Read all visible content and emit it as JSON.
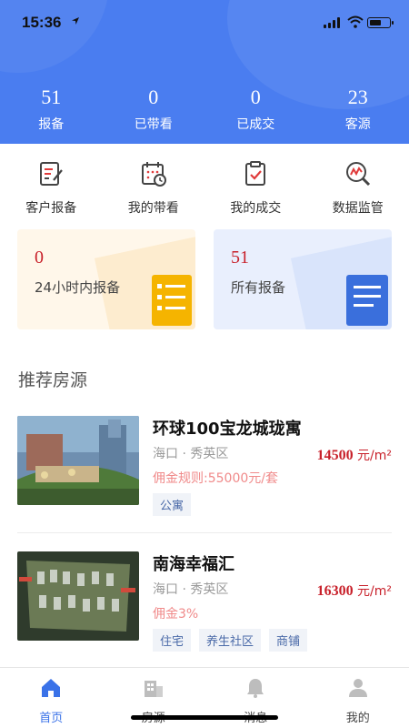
{
  "status_bar": {
    "time": "15:36"
  },
  "stats": [
    {
      "value": "51",
      "label": "报备"
    },
    {
      "value": "0",
      "label": "已带看"
    },
    {
      "value": "0",
      "label": "已成交"
    },
    {
      "value": "23",
      "label": "客源"
    }
  ],
  "actions": [
    {
      "label": "客户报备",
      "icon": "edit-report-icon"
    },
    {
      "label": "我的带看",
      "icon": "calendar-clock-icon"
    },
    {
      "label": "我的成交",
      "icon": "clipboard-check-icon"
    },
    {
      "label": "数据监管",
      "icon": "magnify-chart-icon"
    }
  ],
  "summary_cards": [
    {
      "value": "0",
      "label": "24小时内报备"
    },
    {
      "value": "51",
      "label": "所有报备"
    }
  ],
  "section_title": "推荐房源",
  "listings": [
    {
      "name": "环球100宝龙城珑寓",
      "location": "海口 · 秀英区",
      "price": "14500",
      "price_unit": "元/m²",
      "commission": "佣金规则:55000元/套",
      "tags": [
        "公寓"
      ]
    },
    {
      "name": "南海幸福汇",
      "location": "海口 · 秀英区",
      "price": "16300",
      "price_unit": "元/m²",
      "commission": "佣金3%",
      "tags": [
        "住宅",
        "养生社区",
        "商铺"
      ]
    }
  ],
  "tabbar": [
    {
      "label": "首页",
      "icon": "home-icon",
      "active": true
    },
    {
      "label": "房源",
      "icon": "building-icon",
      "active": false
    },
    {
      "label": "消息",
      "icon": "bell-icon",
      "active": false
    },
    {
      "label": "我的",
      "icon": "user-icon",
      "active": false
    }
  ],
  "colors": {
    "primary": "#4a7df0",
    "price_red": "#c8202a",
    "commission_pink": "#f08a8a",
    "tab_active": "#3a72e8"
  }
}
